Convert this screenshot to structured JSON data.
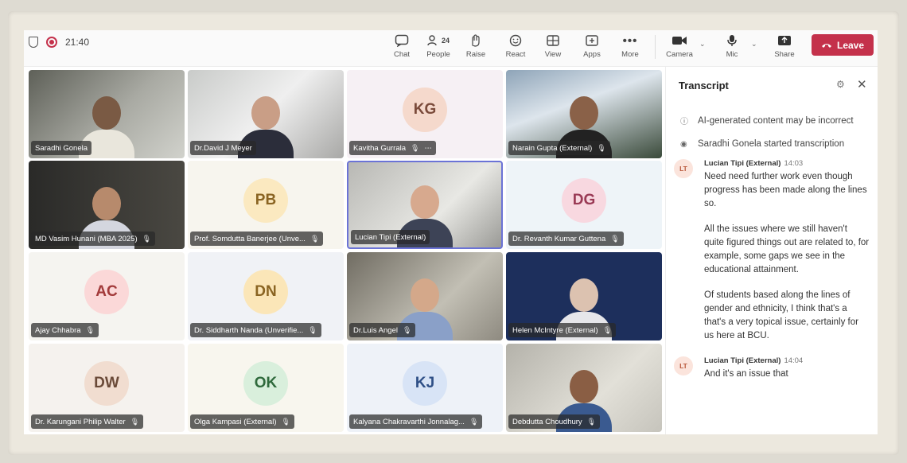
{
  "toolbar": {
    "time": "21:40",
    "people_count": "24",
    "buttons": [
      {
        "label": "Chat",
        "icon": "chat-icon"
      },
      {
        "label": "People",
        "icon": "people-icon"
      },
      {
        "label": "Raise",
        "icon": "raise-hand-icon"
      },
      {
        "label": "React",
        "icon": "react-icon"
      },
      {
        "label": "View",
        "icon": "view-icon"
      },
      {
        "label": "Apps",
        "icon": "apps-icon"
      },
      {
        "label": "More",
        "icon": "more-icon"
      },
      {
        "label": "Camera",
        "icon": "camera-icon"
      },
      {
        "label": "Mic",
        "icon": "mic-icon"
      },
      {
        "label": "Share",
        "icon": "share-icon"
      }
    ],
    "leave_label": "Leave",
    "leave_color": "#c4314b"
  },
  "participants": [
    {
      "name": "Saradhi Gonela",
      "type": "video"
    },
    {
      "name": "Dr.David J Meyer",
      "type": "video"
    },
    {
      "name": "Kavitha Gurrala",
      "type": "avatar",
      "initials": "KG"
    },
    {
      "name": "Narain Gupta (External)",
      "type": "video"
    },
    {
      "name": "MD Vasim Hunani (MBA 2025)",
      "type": "video"
    },
    {
      "name": "Prof. Somdutta Banerjee (Unve...",
      "type": "avatar",
      "initials": "PB"
    },
    {
      "name": "Lucian Tipi (External)",
      "type": "video",
      "active": true
    },
    {
      "name": "Dr. Revanth Kumar Guttena",
      "type": "avatar",
      "initials": "DG"
    },
    {
      "name": "Ajay Chhabra",
      "type": "avatar",
      "initials": "AC"
    },
    {
      "name": "Dr. Siddharth Nanda (Unverifie...",
      "type": "avatar",
      "initials": "DN"
    },
    {
      "name": "Dr.Luis Angel",
      "type": "video"
    },
    {
      "name": "Helen McIntyre (External)",
      "type": "video"
    },
    {
      "name": "Dr. Karungani Philip Walter",
      "type": "avatar",
      "initials": "DW"
    },
    {
      "name": "Olga Kampasi (External)",
      "type": "avatar",
      "initials": "OK"
    },
    {
      "name": "Kalyana Chakravarthi Jonnalag...",
      "type": "avatar",
      "initials": "KJ"
    },
    {
      "name": "Debdutta Choudhury",
      "type": "video"
    }
  ],
  "transcript": {
    "title": "Transcript",
    "notice": "AI-generated content may be incorrect",
    "started": "Saradhi Gonela started transcription",
    "messages": [
      {
        "initials": "LT",
        "speaker": "Lucian Tipi (External)",
        "time": "14:03",
        "paragraphs": [
          "Need need further work even though progress has been made along the lines so.",
          "All the issues where we still haven't quite figured things out are related to, for example, some gaps we see in the educational attainment.",
          "Of students based along the lines of gender and ethnicity, I think that's a that's a very topical issue, certainly for us here at BCU."
        ]
      },
      {
        "initials": "LT",
        "speaker": "Lucian Tipi (External)",
        "time": "14:04",
        "paragraphs": [
          "And it's an issue that"
        ]
      }
    ]
  }
}
